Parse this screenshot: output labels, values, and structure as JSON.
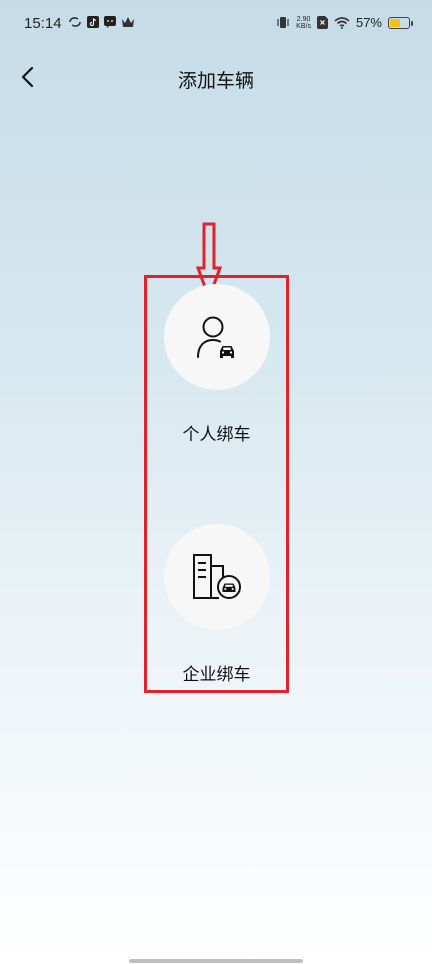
{
  "status_bar": {
    "time": "15:14",
    "net_speed_value": "2.90",
    "net_speed_unit": "KB/s",
    "battery_percent": "57%",
    "battery_level": 0.57,
    "battery_color": "#f2c01b"
  },
  "header": {
    "title": "添加车辆"
  },
  "options": [
    {
      "label": "个人绑车",
      "icon": "person-car-icon"
    },
    {
      "label": "企业绑车",
      "icon": "building-car-icon"
    }
  ],
  "annotation": {
    "highlight_color": "#e0222a"
  }
}
